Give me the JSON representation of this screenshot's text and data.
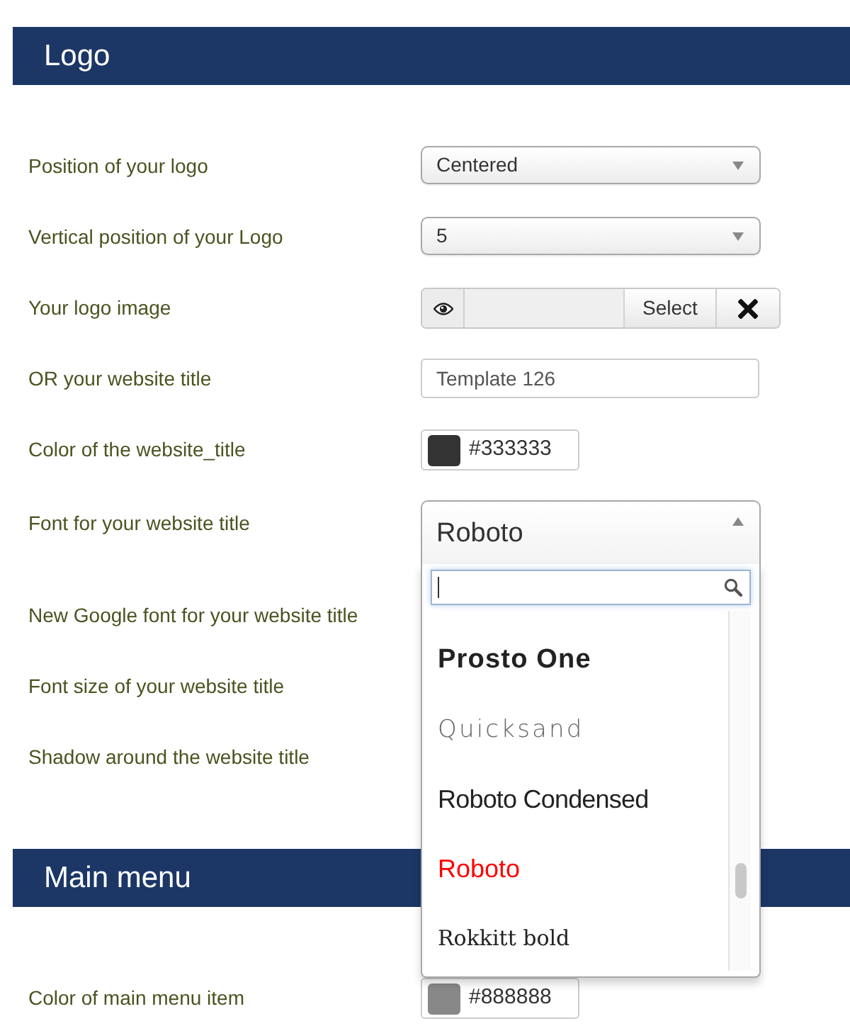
{
  "sections": [
    {
      "title": "Logo",
      "fields": [
        {
          "label": "Position of your logo",
          "control": {
            "kind": "select",
            "value": "Centered"
          }
        },
        {
          "label": "Vertical position of your Logo",
          "control": {
            "kind": "select",
            "value": "5"
          }
        },
        {
          "label": "Your logo image",
          "control": {
            "kind": "image",
            "button": "Select"
          }
        },
        {
          "label": "OR your website title",
          "control": {
            "kind": "text",
            "value": "Template 126"
          }
        },
        {
          "label": "Color of the website_title",
          "control": {
            "kind": "color",
            "value": "#333333",
            "color": "#333333"
          }
        },
        {
          "label": "Font for your website title",
          "control": {
            "kind": "font",
            "value": "Roboto",
            "expanded": true,
            "options": [
              {
                "label": "Prosto One",
                "kind": "display",
                "selected": false
              },
              {
                "label": "Quicksand",
                "kind": "thin",
                "selected": false
              },
              {
                "label": "Roboto Condensed",
                "kind": "narrow",
                "selected": false
              },
              {
                "label": "Roboto",
                "kind": "plain",
                "selected": true
              },
              {
                "label": "Rokkitt bold",
                "kind": "slab",
                "selected": false
              }
            ]
          }
        },
        {
          "label": "New Google font for your website title"
        },
        {
          "label": "Font size of your website title"
        },
        {
          "label": "Shadow around the website title"
        }
      ]
    },
    {
      "title": "Main menu",
      "fields": [
        {
          "label": "Color of main menu item",
          "control": {
            "kind": "color",
            "value": "#888888",
            "color": "#888888"
          }
        }
      ]
    }
  ]
}
